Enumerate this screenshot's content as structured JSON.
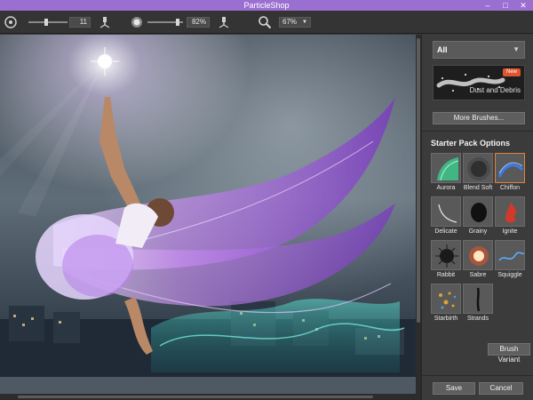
{
  "window": {
    "title": "ParticleShop",
    "min_glyph": "–",
    "max_glyph": "□",
    "close_glyph": "✕"
  },
  "toolbar": {
    "size_value": "11",
    "opacity_value": "82%",
    "zoom_value": "67%",
    "size_slider_level": 0.45,
    "opacity_slider_level": 0.82
  },
  "panel": {
    "category": "All",
    "featured_badge": "New",
    "featured_label": "Dust and Debris",
    "more_brushes_label": "More Brushes...",
    "section_title": "Starter Pack Options",
    "brush_variant_label": "Brush Variant",
    "save_label": "Save",
    "cancel_label": "Cancel",
    "brushes": [
      {
        "name": "Aurora",
        "icon": "aurora-icon"
      },
      {
        "name": "Blend Soft",
        "icon": "blend-soft-icon"
      },
      {
        "name": "Chiffon",
        "icon": "chiffon-icon",
        "selected": true
      },
      {
        "name": "Delicate",
        "icon": "delicate-icon"
      },
      {
        "name": "Grainy",
        "icon": "grainy-icon"
      },
      {
        "name": "Ignite",
        "icon": "ignite-icon"
      },
      {
        "name": "Rabbit",
        "icon": "rabbit-icon"
      },
      {
        "name": "Sabre",
        "icon": "sabre-icon"
      },
      {
        "name": "Squiggle",
        "icon": "squiggle-icon"
      },
      {
        "name": "Starbirth",
        "icon": "starbirth-icon"
      },
      {
        "name": "Strands",
        "icon": "strands-icon"
      }
    ]
  },
  "colors": {
    "titlebar": "#9a6fd1",
    "selected_border": "#e0823e",
    "badge": "#e0552e"
  }
}
